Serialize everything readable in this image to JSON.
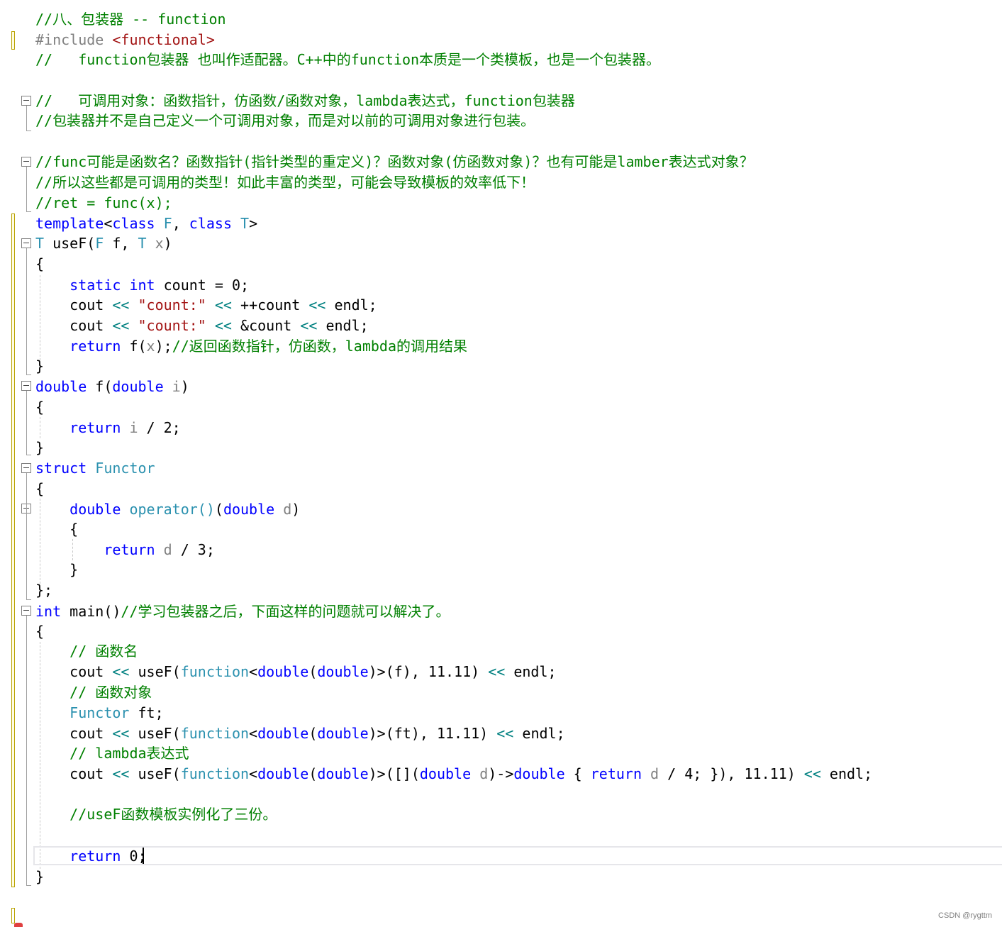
{
  "editor": {
    "lines": [
      [
        {
          "t": "//八、包装器 -- function",
          "c": "cmt"
        }
      ],
      [
        {
          "t": "#include ",
          "c": "macro"
        },
        {
          "t": "<functional>",
          "c": "inc"
        }
      ],
      [
        {
          "t": "//   function包装器 也叫作适配器。C++中的function本质是一个类模板，也是一个包装器。",
          "c": "cmt"
        }
      ],
      [],
      [
        {
          "t": "//   可调用对象：函数指针，仿函数/函数对象，lambda表达式，function包装器",
          "c": "cmt"
        }
      ],
      [
        {
          "t": "//包装器并不是自己定义一个可调用对象，而是对以前的可调用对象进行包装。",
          "c": "cmt"
        }
      ],
      [],
      [
        {
          "t": "//func可能是函数名？函数指针(指针类型的重定义)？函数对象(仿函数对象)？也有可能是lamber表达式对象？",
          "c": "cmt"
        }
      ],
      [
        {
          "t": "//所以这些都是可调用的类型！如此丰富的类型，可能会导致模板的效率低下！",
          "c": "cmt"
        }
      ],
      [
        {
          "t": "//ret = func(x);",
          "c": "cmt"
        }
      ],
      [
        {
          "t": "template",
          "c": "kw"
        },
        {
          "t": "<",
          "c": "plain"
        },
        {
          "t": "class",
          "c": "kw"
        },
        {
          "t": " ",
          "c": "plain"
        },
        {
          "t": "F",
          "c": "type"
        },
        {
          "t": ", ",
          "c": "plain"
        },
        {
          "t": "class",
          "c": "kw"
        },
        {
          "t": " ",
          "c": "plain"
        },
        {
          "t": "T",
          "c": "type"
        },
        {
          "t": ">",
          "c": "plain"
        }
      ],
      [
        {
          "t": "T",
          "c": "type"
        },
        {
          "t": " useF(",
          "c": "plain"
        },
        {
          "t": "F",
          "c": "type"
        },
        {
          "t": " f, ",
          "c": "plain"
        },
        {
          "t": "T",
          "c": "type"
        },
        {
          "t": " ",
          "c": "plain"
        },
        {
          "t": "x",
          "c": "param"
        },
        {
          "t": ")",
          "c": "plain"
        }
      ],
      [
        {
          "t": "{",
          "c": "plain"
        }
      ],
      [
        {
          "t": "    ",
          "c": "plain"
        },
        {
          "t": "static",
          "c": "kw"
        },
        {
          "t": " ",
          "c": "plain"
        },
        {
          "t": "int",
          "c": "kw"
        },
        {
          "t": " count = 0;",
          "c": "plain"
        }
      ],
      [
        {
          "t": "    cout ",
          "c": "plain"
        },
        {
          "t": "<<",
          "c": "op"
        },
        {
          "t": " ",
          "c": "plain"
        },
        {
          "t": "\"count:\"",
          "c": "str"
        },
        {
          "t": " ",
          "c": "plain"
        },
        {
          "t": "<<",
          "c": "op"
        },
        {
          "t": " ++count ",
          "c": "plain"
        },
        {
          "t": "<<",
          "c": "op"
        },
        {
          "t": " endl;",
          "c": "plain"
        }
      ],
      [
        {
          "t": "    cout ",
          "c": "plain"
        },
        {
          "t": "<<",
          "c": "op"
        },
        {
          "t": " ",
          "c": "plain"
        },
        {
          "t": "\"count:\"",
          "c": "str"
        },
        {
          "t": " ",
          "c": "plain"
        },
        {
          "t": "<<",
          "c": "op"
        },
        {
          "t": " &count ",
          "c": "plain"
        },
        {
          "t": "<<",
          "c": "op"
        },
        {
          "t": " endl;",
          "c": "plain"
        }
      ],
      [
        {
          "t": "    ",
          "c": "plain"
        },
        {
          "t": "return",
          "c": "kw"
        },
        {
          "t": " f(",
          "c": "plain"
        },
        {
          "t": "x",
          "c": "param"
        },
        {
          "t": ");",
          "c": "plain"
        },
        {
          "t": "//返回函数指针，仿函数，lambda的调用结果",
          "c": "cmt"
        }
      ],
      [
        {
          "t": "}",
          "c": "plain"
        }
      ],
      [
        {
          "t": "double",
          "c": "kw"
        },
        {
          "t": " f(",
          "c": "plain"
        },
        {
          "t": "double",
          "c": "kw"
        },
        {
          "t": " ",
          "c": "plain"
        },
        {
          "t": "i",
          "c": "param"
        },
        {
          "t": ")",
          "c": "plain"
        }
      ],
      [
        {
          "t": "{",
          "c": "plain"
        }
      ],
      [
        {
          "t": "    ",
          "c": "plain"
        },
        {
          "t": "return",
          "c": "kw"
        },
        {
          "t": " ",
          "c": "plain"
        },
        {
          "t": "i",
          "c": "param"
        },
        {
          "t": " / 2;",
          "c": "plain"
        }
      ],
      [
        {
          "t": "}",
          "c": "plain"
        }
      ],
      [
        {
          "t": "struct",
          "c": "kw"
        },
        {
          "t": " ",
          "c": "plain"
        },
        {
          "t": "Functor",
          "c": "type"
        }
      ],
      [
        {
          "t": "{",
          "c": "plain"
        }
      ],
      [
        {
          "t": "    ",
          "c": "plain"
        },
        {
          "t": "double",
          "c": "kw"
        },
        {
          "t": " ",
          "c": "plain"
        },
        {
          "t": "operator()",
          "c": "type"
        },
        {
          "t": "(",
          "c": "plain"
        },
        {
          "t": "double",
          "c": "kw"
        },
        {
          "t": " ",
          "c": "plain"
        },
        {
          "t": "d",
          "c": "param"
        },
        {
          "t": ")",
          "c": "plain"
        }
      ],
      [
        {
          "t": "    {",
          "c": "plain"
        }
      ],
      [
        {
          "t": "        ",
          "c": "plain"
        },
        {
          "t": "return",
          "c": "kw"
        },
        {
          "t": " ",
          "c": "plain"
        },
        {
          "t": "d",
          "c": "param"
        },
        {
          "t": " / 3;",
          "c": "plain"
        }
      ],
      [
        {
          "t": "    }",
          "c": "plain"
        }
      ],
      [
        {
          "t": "};",
          "c": "plain"
        }
      ],
      [
        {
          "t": "int",
          "c": "kw"
        },
        {
          "t": " main()",
          "c": "plain"
        },
        {
          "t": "//学习包装器之后，下面这样的问题就可以解决了。",
          "c": "cmt"
        }
      ],
      [
        {
          "t": "{",
          "c": "plain"
        }
      ],
      [
        {
          "t": "    ",
          "c": "plain"
        },
        {
          "t": "// 函数名",
          "c": "cmt"
        }
      ],
      [
        {
          "t": "    cout ",
          "c": "plain"
        },
        {
          "t": "<<",
          "c": "op"
        },
        {
          "t": " useF(",
          "c": "plain"
        },
        {
          "t": "function",
          "c": "type"
        },
        {
          "t": "<",
          "c": "plain"
        },
        {
          "t": "double",
          "c": "kw"
        },
        {
          "t": "(",
          "c": "plain"
        },
        {
          "t": "double",
          "c": "kw"
        },
        {
          "t": ")>(f), 11.11) ",
          "c": "plain"
        },
        {
          "t": "<<",
          "c": "op"
        },
        {
          "t": " endl;",
          "c": "plain"
        }
      ],
      [
        {
          "t": "    ",
          "c": "plain"
        },
        {
          "t": "// 函数对象",
          "c": "cmt"
        }
      ],
      [
        {
          "t": "    ",
          "c": "plain"
        },
        {
          "t": "Functor",
          "c": "type"
        },
        {
          "t": " ft;",
          "c": "plain"
        }
      ],
      [
        {
          "t": "    cout ",
          "c": "plain"
        },
        {
          "t": "<<",
          "c": "op"
        },
        {
          "t": " useF(",
          "c": "plain"
        },
        {
          "t": "function",
          "c": "type"
        },
        {
          "t": "<",
          "c": "plain"
        },
        {
          "t": "double",
          "c": "kw"
        },
        {
          "t": "(",
          "c": "plain"
        },
        {
          "t": "double",
          "c": "kw"
        },
        {
          "t": ")>(ft), 11.11) ",
          "c": "plain"
        },
        {
          "t": "<<",
          "c": "op"
        },
        {
          "t": " endl;",
          "c": "plain"
        }
      ],
      [
        {
          "t": "    ",
          "c": "plain"
        },
        {
          "t": "// lambda表达式",
          "c": "cmt"
        }
      ],
      [
        {
          "t": "    cout ",
          "c": "plain"
        },
        {
          "t": "<<",
          "c": "op"
        },
        {
          "t": " useF(",
          "c": "plain"
        },
        {
          "t": "function",
          "c": "type"
        },
        {
          "t": "<",
          "c": "plain"
        },
        {
          "t": "double",
          "c": "kw"
        },
        {
          "t": "(",
          "c": "plain"
        },
        {
          "t": "double",
          "c": "kw"
        },
        {
          "t": ")>([](",
          "c": "plain"
        },
        {
          "t": "double",
          "c": "kw"
        },
        {
          "t": " ",
          "c": "plain"
        },
        {
          "t": "d",
          "c": "param"
        },
        {
          "t": ")->",
          "c": "plain"
        },
        {
          "t": "double",
          "c": "kw"
        },
        {
          "t": " { ",
          "c": "plain"
        },
        {
          "t": "return",
          "c": "kw"
        },
        {
          "t": " ",
          "c": "plain"
        },
        {
          "t": "d",
          "c": "param"
        },
        {
          "t": " / 4; }), 11.11) ",
          "c": "plain"
        },
        {
          "t": "<<",
          "c": "op"
        },
        {
          "t": " endl;",
          "c": "plain"
        }
      ],
      [],
      [
        {
          "t": "    ",
          "c": "plain"
        },
        {
          "t": "//useF函数模板实例化了三份。",
          "c": "cmt"
        }
      ],
      [],
      [
        {
          "t": "    ",
          "c": "plain"
        },
        {
          "t": "return",
          "c": "kw"
        },
        {
          "t": " 0;",
          "c": "plain"
        }
      ],
      [
        {
          "t": "}",
          "c": "plain"
        }
      ]
    ]
  },
  "watermark": "CSDN @rygttm",
  "colors": {
    "comment": "#008000",
    "keyword": "#0000ff",
    "type": "#2b91af",
    "string": "#a31515",
    "change_bar": "#b8a200"
  }
}
